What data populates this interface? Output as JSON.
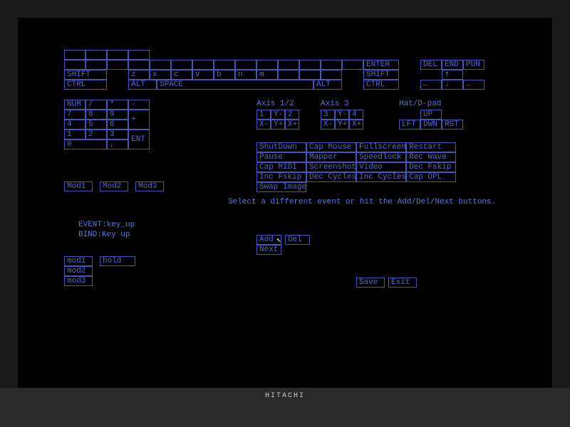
{
  "keyboard": {
    "row_shift_label": "SHIFT",
    "row_ctrl_left": "CTRL",
    "row_alt_left": "ALT",
    "row_space": "SPACE",
    "row_alt_right": "ALT",
    "row_ctrl_right": "CTRL",
    "row_shift_right": "SHIFT",
    "enter": "ENTER",
    "del": "DEL",
    "end": "END",
    "pun": "PUN",
    "top_letters": [
      "z",
      "x",
      "c",
      "v",
      "b",
      "n",
      "m"
    ],
    "plus": "+",
    "minus": "-"
  },
  "numpad": {
    "head": [
      "NUM",
      "/",
      "*",
      "-"
    ],
    "r1": [
      "7",
      "8",
      "9",
      "+"
    ],
    "r2": [
      "4",
      "5",
      "6"
    ],
    "r3": [
      "1",
      "2",
      "3",
      "ENT"
    ],
    "r4": [
      "0",
      ","
    ]
  },
  "axes": {
    "a12_title": "Axis 1/2",
    "a12": [
      "1",
      "Y-",
      "2",
      "X-",
      "Y+",
      "X+"
    ],
    "a3_title": "Axis 3",
    "a3": [
      "3",
      "Y-",
      "4",
      "X-",
      "Y+",
      "X+"
    ],
    "hat_title": "Hat/D-pad",
    "hat": [
      "UP",
      "LFT",
      "DWN",
      "RGT"
    ]
  },
  "actions": {
    "r1": [
      "ShutDown",
      "Cap Mouse",
      "Fullscreen",
      "Restart"
    ],
    "r2": [
      "Pause",
      "Mapper",
      "Speedlock",
      "Rec Wave"
    ],
    "r3": [
      "Cap MIDI",
      "Screenshot",
      "Video",
      "Dec Fskip"
    ],
    "r4": [
      "Inc Fskip",
      "Dec Cycles",
      "Inc Cycles",
      "Cap OPL"
    ],
    "r5": [
      "Swap Image"
    ]
  },
  "mods": {
    "m1": "Mod1",
    "m2": "Mod2",
    "m3": "Mod3"
  },
  "hint": "Select a different event or hit the Add/Del/Next buttons.",
  "event_label": "EVENT:key_up",
  "bind_label": "BIND:Key up",
  "btns": {
    "add": "Add",
    "del": "Del",
    "next": "Next",
    "save": "Save",
    "exit": "Exit"
  },
  "bindmods": {
    "m1": "mod1",
    "m2": "mod2",
    "m3": "mod3",
    "hold": "hold"
  },
  "monitor_brand": "HITACHI"
}
